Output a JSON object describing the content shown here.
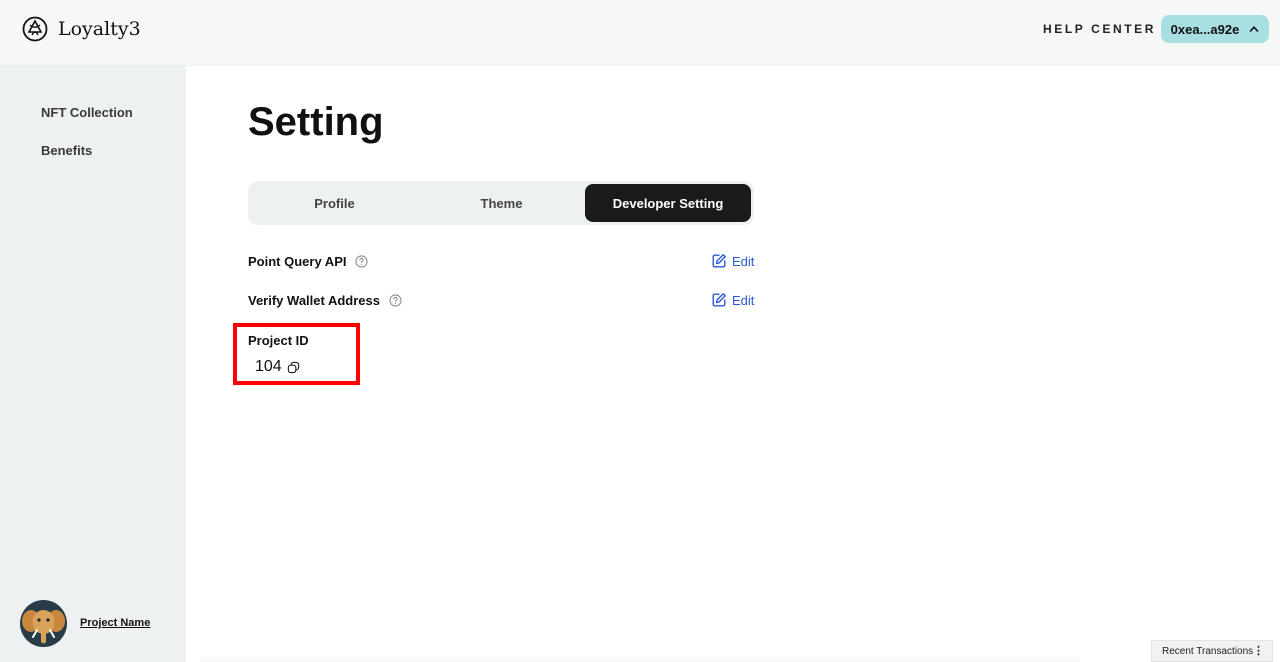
{
  "header": {
    "logo_text": "Loyalty3",
    "help_center": "HELP CENTER",
    "wallet_address": "0xea...a92e"
  },
  "sidebar": {
    "items": [
      {
        "label": "NFT Collection"
      },
      {
        "label": "Benefits"
      }
    ],
    "project_name": "Project Name"
  },
  "main": {
    "title": "Setting",
    "tabs": [
      {
        "label": "Profile",
        "active": false
      },
      {
        "label": "Theme",
        "active": false
      },
      {
        "label": "Developer Setting",
        "active": true
      }
    ],
    "rows": [
      {
        "label": "Point Query API",
        "action": "Edit"
      },
      {
        "label": "Verify Wallet Address",
        "action": "Edit"
      }
    ],
    "project_id": {
      "label": "Project ID",
      "value": "104"
    }
  },
  "footer": {
    "recent_transactions": "Recent Transactions",
    "menu_glyph": "⋮"
  },
  "colors": {
    "accent_link": "#2a5bd6",
    "wallet_bg": "#a8dfe0",
    "active_tab_bg": "#1a1a1d",
    "highlight": "#ff0000"
  }
}
